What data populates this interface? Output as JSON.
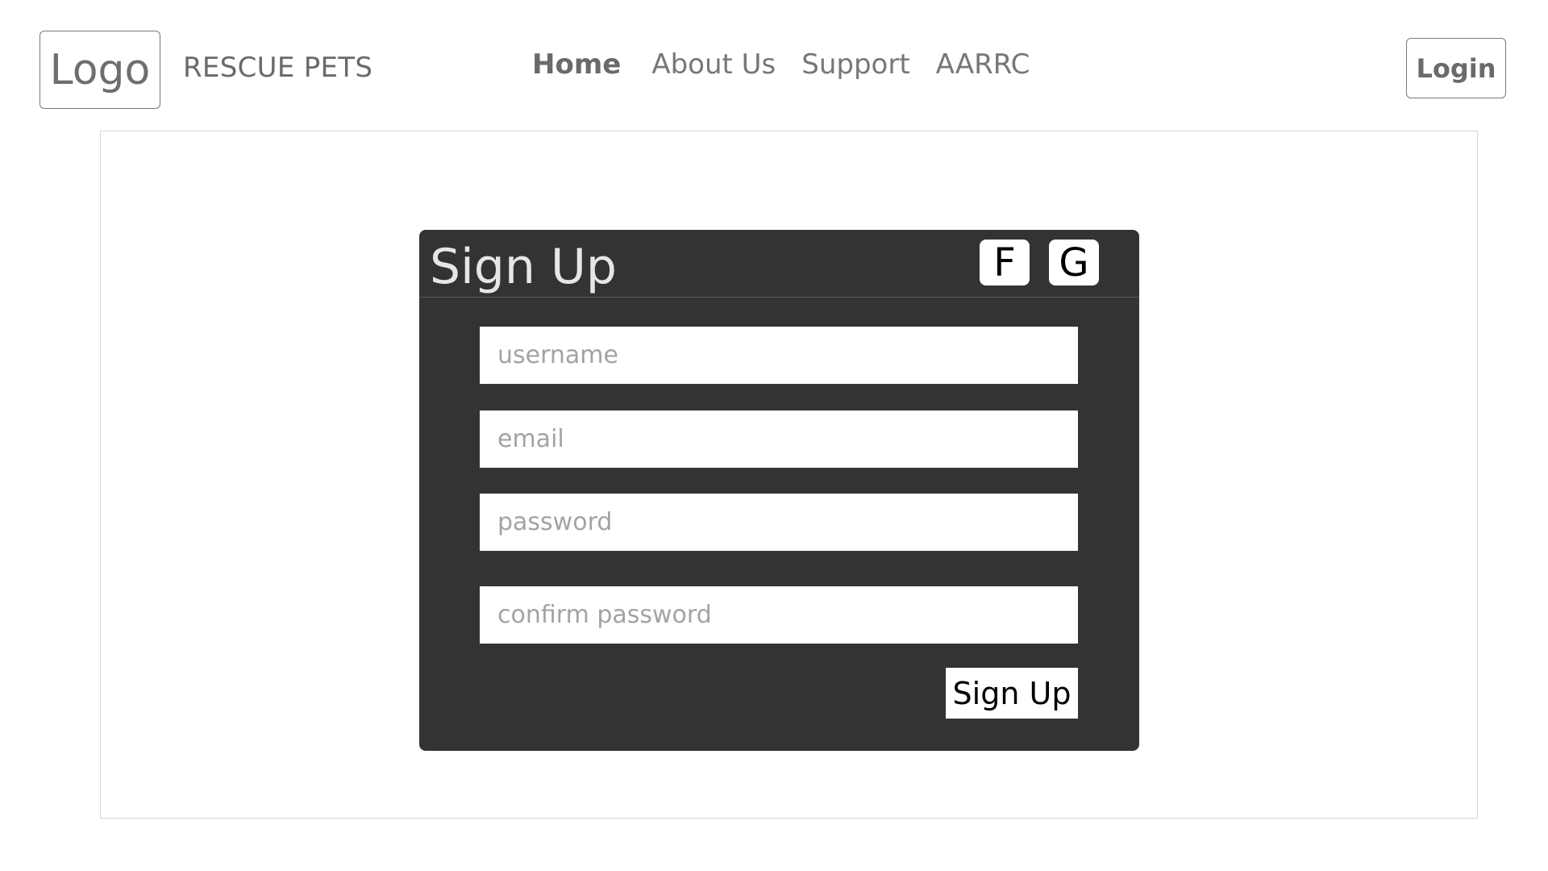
{
  "header": {
    "logo_text": "Logo",
    "brand": "RESCUE PETS",
    "nav": [
      {
        "label": "Home",
        "active": true
      },
      {
        "label": "About Us",
        "active": false
      },
      {
        "label": "Support",
        "active": false
      },
      {
        "label": "AARRC",
        "active": false
      }
    ],
    "login_label": "Login"
  },
  "signup": {
    "title": "Sign Up",
    "social": {
      "facebook_label": "F",
      "google_label": "G"
    },
    "fields": {
      "username_placeholder": "username",
      "email_placeholder": "email",
      "password_placeholder": "password",
      "confirm_placeholder": "confirm password"
    },
    "submit_label": "Sign Up"
  },
  "colors": {
    "card_background": "#333333",
    "text_gray": "#6a6a6a",
    "placeholder_gray": "#a3a3a3"
  }
}
